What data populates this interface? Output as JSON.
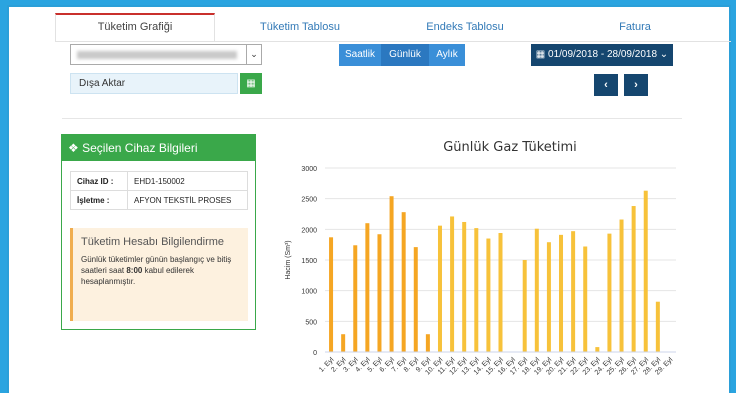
{
  "tabs": [
    {
      "label": "Tüketim Grafiği",
      "active": true
    },
    {
      "label": "Tüketim Tablosu",
      "active": false
    },
    {
      "label": "Endeks Tablosu",
      "active": false
    },
    {
      "label": "Fatura",
      "active": false
    }
  ],
  "export": {
    "label": "Dışa Aktar",
    "icon": "excel-icon"
  },
  "periods": [
    {
      "label": "Saatlik",
      "active": false
    },
    {
      "label": "Günlük",
      "active": true
    },
    {
      "label": "Aylık",
      "active": false
    }
  ],
  "date_range": {
    "label": "01/09/2018 - 28/09/2018",
    "icon": "calendar-icon"
  },
  "nav": {
    "prev_icon": "chevron-left-icon",
    "next_icon": "chevron-right-icon"
  },
  "device_panel": {
    "title": "Seçilen Cihaz Bilgileri",
    "rows": [
      {
        "key": "Cihaz ID :",
        "value": "EHD1-150002"
      },
      {
        "key": "İşletme :",
        "value": "AFYON TEKSTİL PROSES"
      }
    ],
    "note_title": "Tüketim Hesabı Bilgilendirme",
    "note_pre": "Günlük tüketimler günün başlangıç ve bitiş saatleri saat ",
    "note_bold": "8:00",
    "note_post": " kabul edilerek hesaplanmıştır."
  },
  "colors": {
    "accent": "#3a8fd8",
    "panel_green": "#3aa84a",
    "bar_orange": "#f5a623",
    "bar_yellow": "#f7c23a",
    "dark_navy": "#15466f"
  },
  "chart_data": {
    "type": "bar",
    "title": "Günlük Gaz Tüketimi",
    "ylabel": "Hacim (Sm³)",
    "xlabel": "",
    "ylim": [
      0,
      3000
    ],
    "yticks": [
      0,
      500,
      1000,
      1500,
      2000,
      2500,
      3000
    ],
    "categories": [
      "1. Eyl",
      "2. Eyl",
      "3. Eyl",
      "4. Eyl",
      "5. Eyl",
      "6. Eyl",
      "7. Eyl",
      "8. Eyl",
      "9. Eyl",
      "10. Eyl",
      "11. Eyl",
      "12. Eyl",
      "13. Eyl",
      "14. Eyl",
      "15. Eyl",
      "16. Eyl",
      "17. Eyl",
      "18. Eyl",
      "19. Eyl",
      "20. Eyl",
      "21. Eyl",
      "22. Eyl",
      "23. Eyl",
      "24. Eyl",
      "25. Eyl",
      "26. Eyl",
      "27. Eyl",
      "28. Eyl",
      "29. Eyl"
    ],
    "values": [
      1870,
      290,
      1740,
      2100,
      1920,
      2540,
      2280,
      1710,
      290,
      2060,
      2210,
      2120,
      2020,
      1850,
      1940,
      0,
      1500,
      2010,
      1790,
      1910,
      1970,
      1720,
      80,
      1930,
      2160,
      2380,
      2630,
      820,
      0
    ],
    "grid": true,
    "legend": "none"
  }
}
